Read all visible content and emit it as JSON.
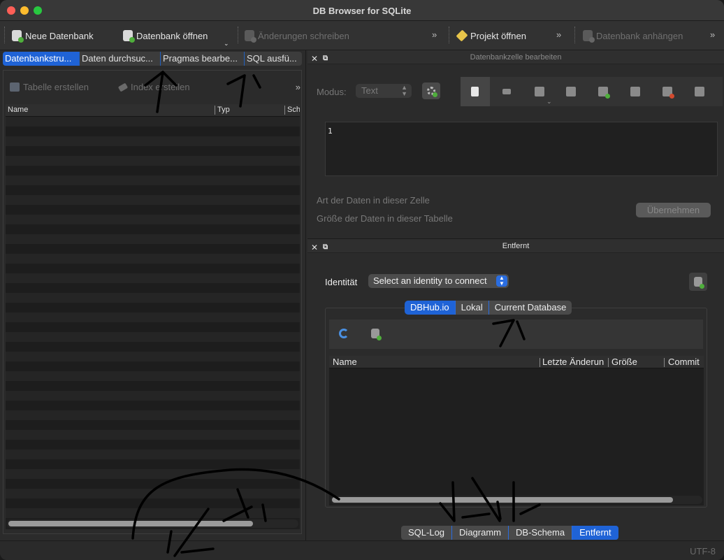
{
  "window": {
    "title": "DB Browser for SQLite"
  },
  "toolbar": {
    "new_db": "Neue Datenbank",
    "open_db": "Datenbank öffnen",
    "write_changes": "Änderungen schreiben",
    "open_project": "Projekt öffnen",
    "attach_db": "Datenbank anhängen",
    "more": "»"
  },
  "left_tabs": [
    "Datenbankstru...",
    "Daten durchsuc...",
    "Pragmas bearbe...",
    "SQL ausfü..."
  ],
  "left_tabs_active": 0,
  "structure": {
    "create_table": "Tabelle erstellen",
    "create_index": "Index erstellen",
    "more": "»",
    "columns": [
      "Name",
      "Typ",
      "Sch"
    ]
  },
  "cell_editor": {
    "title": "Datenbankzelle bearbeiten",
    "mode_label": "Modus:",
    "mode_value": "Text",
    "content": "1",
    "data_type_label": "Art der Daten in dieser Zelle",
    "data_size_label": "Größe der Daten in dieser Tabelle",
    "apply": "Übernehmen",
    "toolbar_icons": [
      "new-doc-icon",
      "cursor-icon",
      "import-icon",
      "export-icon",
      "set-null-icon",
      "save-icon",
      "cancel-icon",
      "print-icon"
    ]
  },
  "remote": {
    "title": "Entfernt",
    "identity_label": "Identität",
    "identity_placeholder": "Select an identity to connect",
    "tabs": [
      "DBHub.io",
      "Lokal",
      "Current Database"
    ],
    "tabs_active": 0,
    "columns": [
      "Name",
      "Letzte Änderun",
      "Größe",
      "Commit"
    ]
  },
  "bottom_tabs": [
    "SQL-Log",
    "Diagramm",
    "DB-Schema",
    "Entfernt"
  ],
  "bottom_tabs_active": 3,
  "dock_buttons": {
    "close": "✕",
    "float": "⧉"
  },
  "status": {
    "encoding": "UTF-8"
  },
  "colors": {
    "accent": "#1f63d6",
    "window_bg": "#2b2b2b",
    "disabled_text": "#707070"
  }
}
